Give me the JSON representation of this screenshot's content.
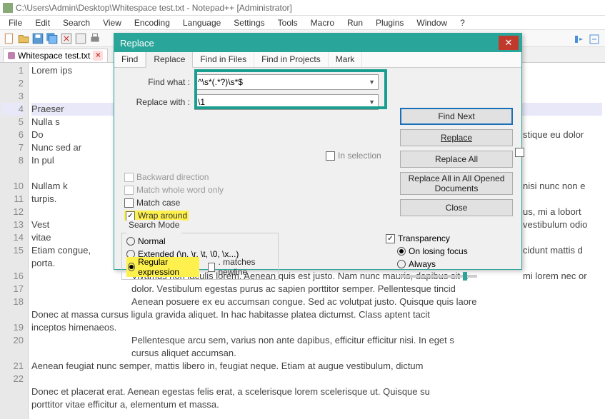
{
  "window": {
    "title": "C:\\Users\\Admin\\Desktop\\Whitespace test.txt - Notepad++ [Administrator]"
  },
  "menu": [
    "File",
    "Edit",
    "Search",
    "View",
    "Encoding",
    "Language",
    "Settings",
    "Tools",
    "Macro",
    "Run",
    "Plugins",
    "Window",
    "?"
  ],
  "tabs": {
    "file": "Whitespace test.txt"
  },
  "gutter": [
    "1",
    "2",
    "3",
    "4",
    "5",
    "6",
    "7",
    "8",
    "",
    "10",
    "11",
    "12",
    "13",
    "14",
    "15",
    "",
    "16",
    "17",
    "18",
    "",
    "19",
    "20",
    "",
    "21",
    "22"
  ],
  "lines": [
    "    Lorem ips",
    "",
    "",
    "    Praeser",
    "      Nulla s",
    "          Do",
    "  Nunc sed ar",
    "      In pul",
    "",
    "    Nullam k",
    "    turpis.",
    "",
    "        Vest",
    "        vitae",
    "Etiam congue,",
    "porta.",
    "",
    "Donec at massa cursus ligula gravida aliquet. In hac habitasse platea dictumst. Class aptent tacit",
    "inceptos himenaeos.",
    "",
    "    Aenean feugiat nunc semper, mattis libero in, feugiat neque. Etiam at augue vestibulum, dictum",
    "",
    "Donec et placerat erat. Aenean egestas felis erat, a scelerisque lorem scelerisque ut. Quisque su",
    "porttitor vitae efficitur a, elementum et massa."
  ],
  "rightText": {
    "a": "stique eu dolor",
    "b": "nisi nunc non e",
    "c": "us, mi a lobort",
    "d": "vestibulum odio",
    "e": "cidunt mattis d",
    "f": "mi lorem nec or",
    "g": "Vivamus non iaculis lorem. Aenean quis est justo. Nam nunc mauris, dapibus sit a",
    "h": "dolor. Vestibulum egestas purus ac sapien porttitor semper. Pellentesque tincid",
    "i": "Aenean posuere ex eu accumsan congue. Sed ac volutpat justo. Quisque quis laore",
    "j": "Pellentesque arcu sem, varius non ante dapibus, efficitur efficitur nisi. In eget s",
    "k": "cursus aliquet accumsan."
  },
  "dialog": {
    "title": "Replace",
    "tabs": [
      "Find",
      "Replace",
      "Find in Files",
      "Find in Projects",
      "Mark"
    ],
    "findLabel": "Find what :",
    "replaceLabel": "Replace with :",
    "findValue": "^\\s*(.*?)\\s*$",
    "replaceValue": "\\1",
    "inSelection": "In selection",
    "backward": "Backward direction",
    "matchWhole": "Match whole word only",
    "matchCase": "Match case",
    "wrap": "Wrap around",
    "searchMode": {
      "legend": "Search Mode",
      "normal": "Normal",
      "extended": "Extended (\\n, \\r, \\t, \\0, \\x...)",
      "regex": "Regular expression",
      "matchesNewline": ". matches newline"
    },
    "transparency": {
      "label": "Transparency",
      "onLosing": "On losing focus",
      "always": "Always"
    },
    "buttons": {
      "findNext": "Find Next",
      "replace": "Replace",
      "replaceAll": "Replace All",
      "replaceAllOpen": "Replace All in All Opened Documents",
      "close": "Close"
    }
  }
}
